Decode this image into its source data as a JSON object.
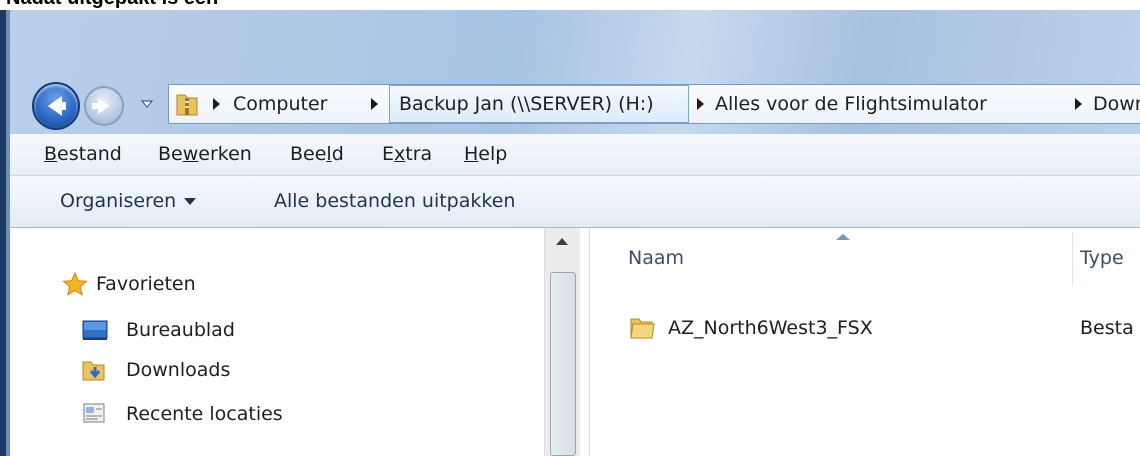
{
  "caption": {
    "text": "Nadat uitgepakt is een"
  },
  "address_bar": {
    "crumbs": [
      "Computer",
      "Backup Jan (\\\\SERVER) (H:)",
      "Alles voor de Flightsimulator",
      "Down"
    ]
  },
  "menu": {
    "items": [
      {
        "pre": "",
        "key": "B",
        "post": "estand"
      },
      {
        "pre": "Be",
        "key": "w",
        "post": "erken"
      },
      {
        "pre": "Bee",
        "key": "l",
        "post": "d"
      },
      {
        "pre": "E",
        "key": "x",
        "post": "tra"
      },
      {
        "pre": "",
        "key": "H",
        "post": "elp"
      }
    ]
  },
  "toolbar": {
    "organize_label": "Organiseren",
    "extract_label": "Alle bestanden uitpakken"
  },
  "nav_pane": {
    "favorites_label": "Favorieten",
    "items": [
      {
        "label": "Bureaublad",
        "icon": "desktop-icon"
      },
      {
        "label": "Downloads",
        "icon": "downloads-folder-icon"
      },
      {
        "label": "Recente locaties",
        "icon": "recent-places-icon"
      }
    ]
  },
  "content": {
    "columns": [
      "Naam",
      "Type"
    ],
    "rows": [
      {
        "name": "AZ_North6West3_FSX",
        "type": "Besta"
      }
    ]
  },
  "colors": {
    "glass": "#a8c3e4",
    "toolbar_text": "#1e3452",
    "accent": "#2c68c6"
  }
}
